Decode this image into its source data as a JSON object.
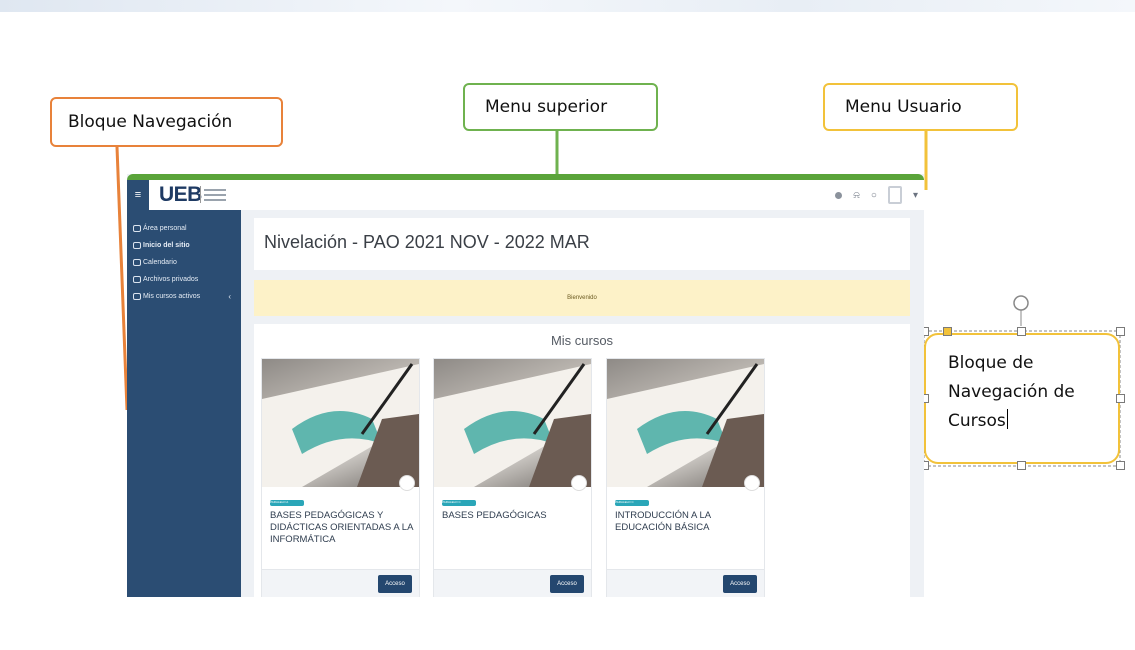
{
  "callouts": {
    "navigation": "Bloque Navegación",
    "top_menu": "Menu superior",
    "user_menu": "Menu Usuario",
    "courses_nav_line1": "Bloque de",
    "courses_nav_line2": "Navegación de",
    "courses_nav_line3": "Cursos"
  },
  "colors": {
    "navigation": "#e8823a",
    "top_menu": "#6fb24f",
    "user_menu": "#f2c23a",
    "sidebar": "#2b4d73"
  },
  "topbar": {
    "menu_icon": "≡",
    "logo": "UEB",
    "icons": [
      "dot-icon",
      "bell-icon",
      "chat-icon",
      "avatar-icon"
    ],
    "user_caret": "▾"
  },
  "sidebar": {
    "items": [
      {
        "label": "Área personal",
        "icon": "dashboard-icon",
        "bold": false
      },
      {
        "label": "Inicio del sitio",
        "icon": "home-icon",
        "bold": true
      },
      {
        "label": "Calendario",
        "icon": "calendar-icon",
        "bold": false
      },
      {
        "label": "Archivos privados",
        "icon": "file-icon",
        "bold": false
      },
      {
        "label": "Mis cursos activos",
        "icon": "graduation-cap-icon",
        "bold": false,
        "chevron": "‹"
      }
    ]
  },
  "main": {
    "page_title": "Nivelación - PAO 2021 NOV - 2022 MAR",
    "welcome": "Bienvenido",
    "courses_title": "Mis cursos",
    "courses": [
      {
        "tag": "PARALELO A",
        "title": "BASES PEDAGÓGICAS Y DIDÁCTICAS ORIENTADAS A LA INFORMÁTICA",
        "button": "Acceso"
      },
      {
        "tag": "PARALELO C",
        "title": "BASES PEDAGÓGICAS",
        "button": "Acceso"
      },
      {
        "tag": "PARALELO C",
        "title": "INTRODUCCIÓN A LA EDUCACIÓN BÁSICA",
        "button": "Acceso"
      }
    ]
  }
}
